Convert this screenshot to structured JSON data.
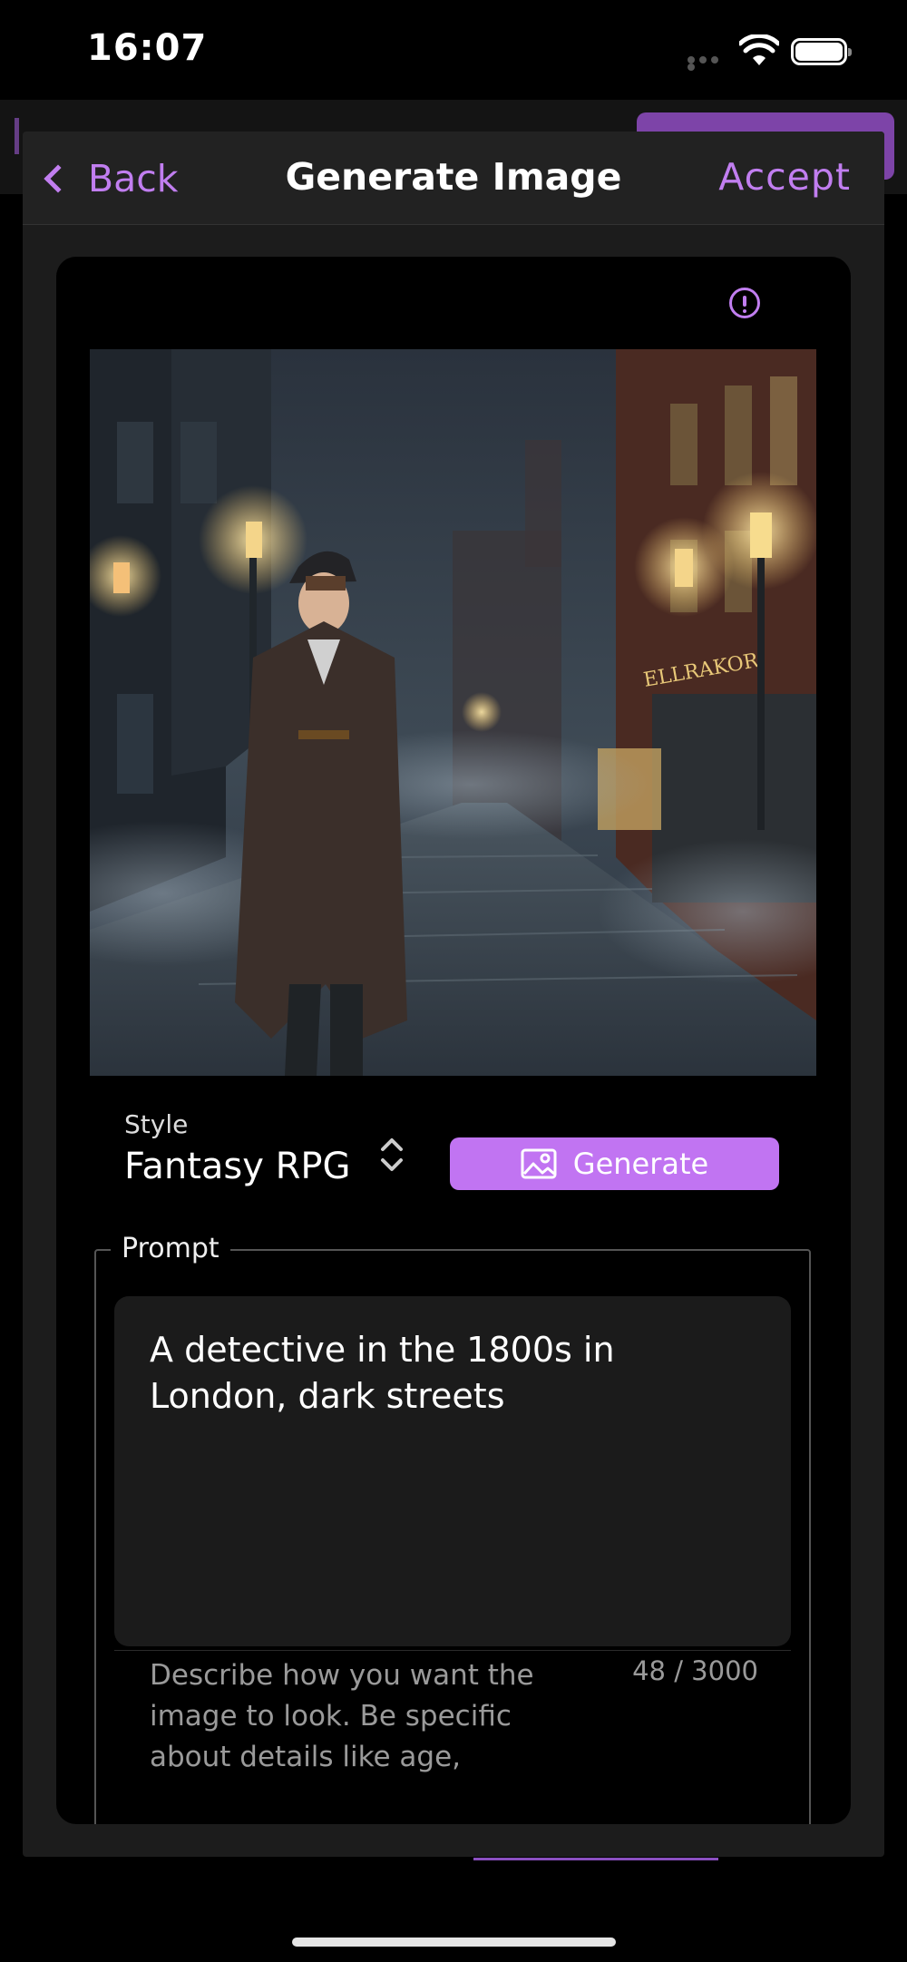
{
  "status_bar": {
    "time": "16:07"
  },
  "nav": {
    "back_label": "Back",
    "title": "Generate Image",
    "accept_label": "Accept"
  },
  "image": {
    "description_icon": "info-icon",
    "alt": "Anime-style detective on a foggy cobblestone London street at night",
    "shop_sign": "ELLRAKOR"
  },
  "style": {
    "label": "Style",
    "value": "Fantasy RPG"
  },
  "generate": {
    "label": "Generate",
    "icon": "image-icon"
  },
  "prompt": {
    "legend": "Prompt",
    "text": "A detective in the 1800s in London, dark streets",
    "helper": "Describe how you want the image to look. Be specific about details like age,",
    "count": "48 / 3000"
  },
  "colors": {
    "accent": "#c17ef0",
    "button": "#c174f2",
    "sheet": "#1c1c1c"
  }
}
